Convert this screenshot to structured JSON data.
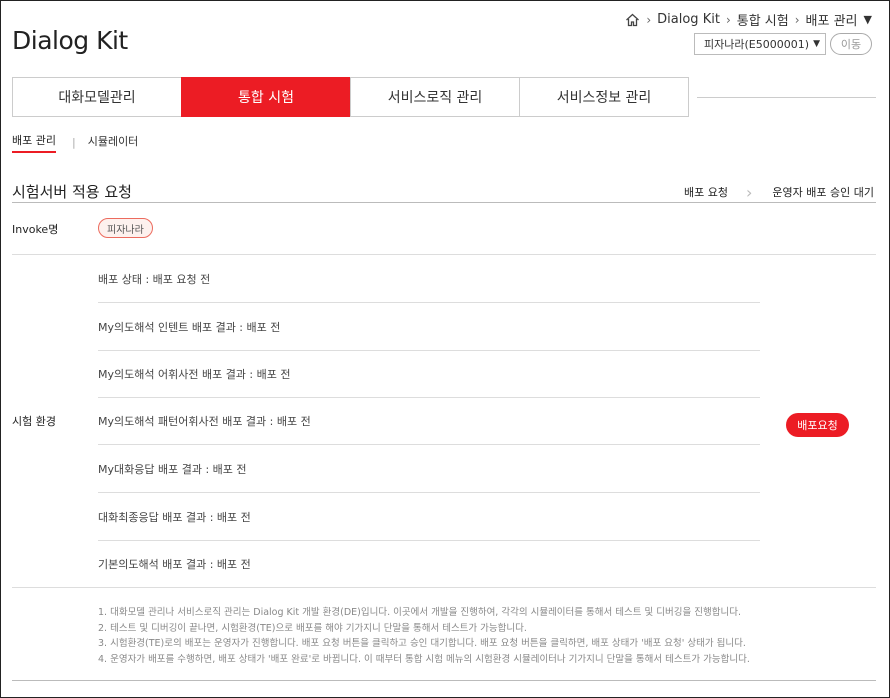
{
  "app": {
    "title": "Dialog Kit"
  },
  "breadcrumb": {
    "items": [
      "Dialog Kit",
      "통합 시험",
      "배포 관리"
    ]
  },
  "toolbar": {
    "project_select": "피자나라(E5000001)",
    "move_label": "이동"
  },
  "tabs": [
    {
      "label": "대화모델관리",
      "active": false
    },
    {
      "label": "통합 시험",
      "active": true
    },
    {
      "label": "서비스로직 관리",
      "active": false
    },
    {
      "label": "서비스정보 관리",
      "active": false
    }
  ],
  "subnav": {
    "active": "배포 관리",
    "other": "시뮬레이터"
  },
  "section": {
    "title": "시험서버 적용 요청",
    "steps": [
      "배포 요청",
      "운영자 배포 승인 대기"
    ]
  },
  "invoke": {
    "label": "Invoke명",
    "tag": "피자나라"
  },
  "env": {
    "label": "시험 환경",
    "rows": [
      "배포 상태 : 배포 요청 전",
      "My의도해석 인텐트 배포 결과 : 배포 전",
      "My의도해석 어휘사전 배포 결과 : 배포 전",
      "My의도해석 패턴어휘사전 배포 결과 : 배포 전",
      "My대화응답 배포 결과 : 배포 전",
      "대화최종응답 배포 결과 : 배포 전",
      "기본의도해석 배포 결과 : 배포 전"
    ],
    "deploy_button": "배포요청"
  },
  "notes": [
    "1. 대화모델 관리나 서비스로직 관리는 Dialog Kit 개발 환경(DE)입니다. 이곳에서 개발을 진행하여, 각각의 시뮬레이터를 통해서 테스트 및 디버깅을 진행합니다.",
    "2. 테스트 및 디버깅이 끝나면, 시험환경(TE)으로 배포를 해야 기가지니 단말을 통해서 테스트가 가능합니다.",
    "3. 시험환경(TE)로의 배포는 운영자가 진행합니다. 배포 요청 버튼을 클릭하고 승인 대기합니다. 배포 요청 버튼을 클릭하면, 배포 상태가 '배포 요청' 상태가 됩니다.",
    "4. 운영자가 배포를 수행하면, 배포 상태가 '배포 완료'로 바뀝니다. 이 때부터 통합 시험 메뉴의 시험환경 시뮬레이터나 기가지니 단말을 통해서 테스트가 가능합니다."
  ]
}
